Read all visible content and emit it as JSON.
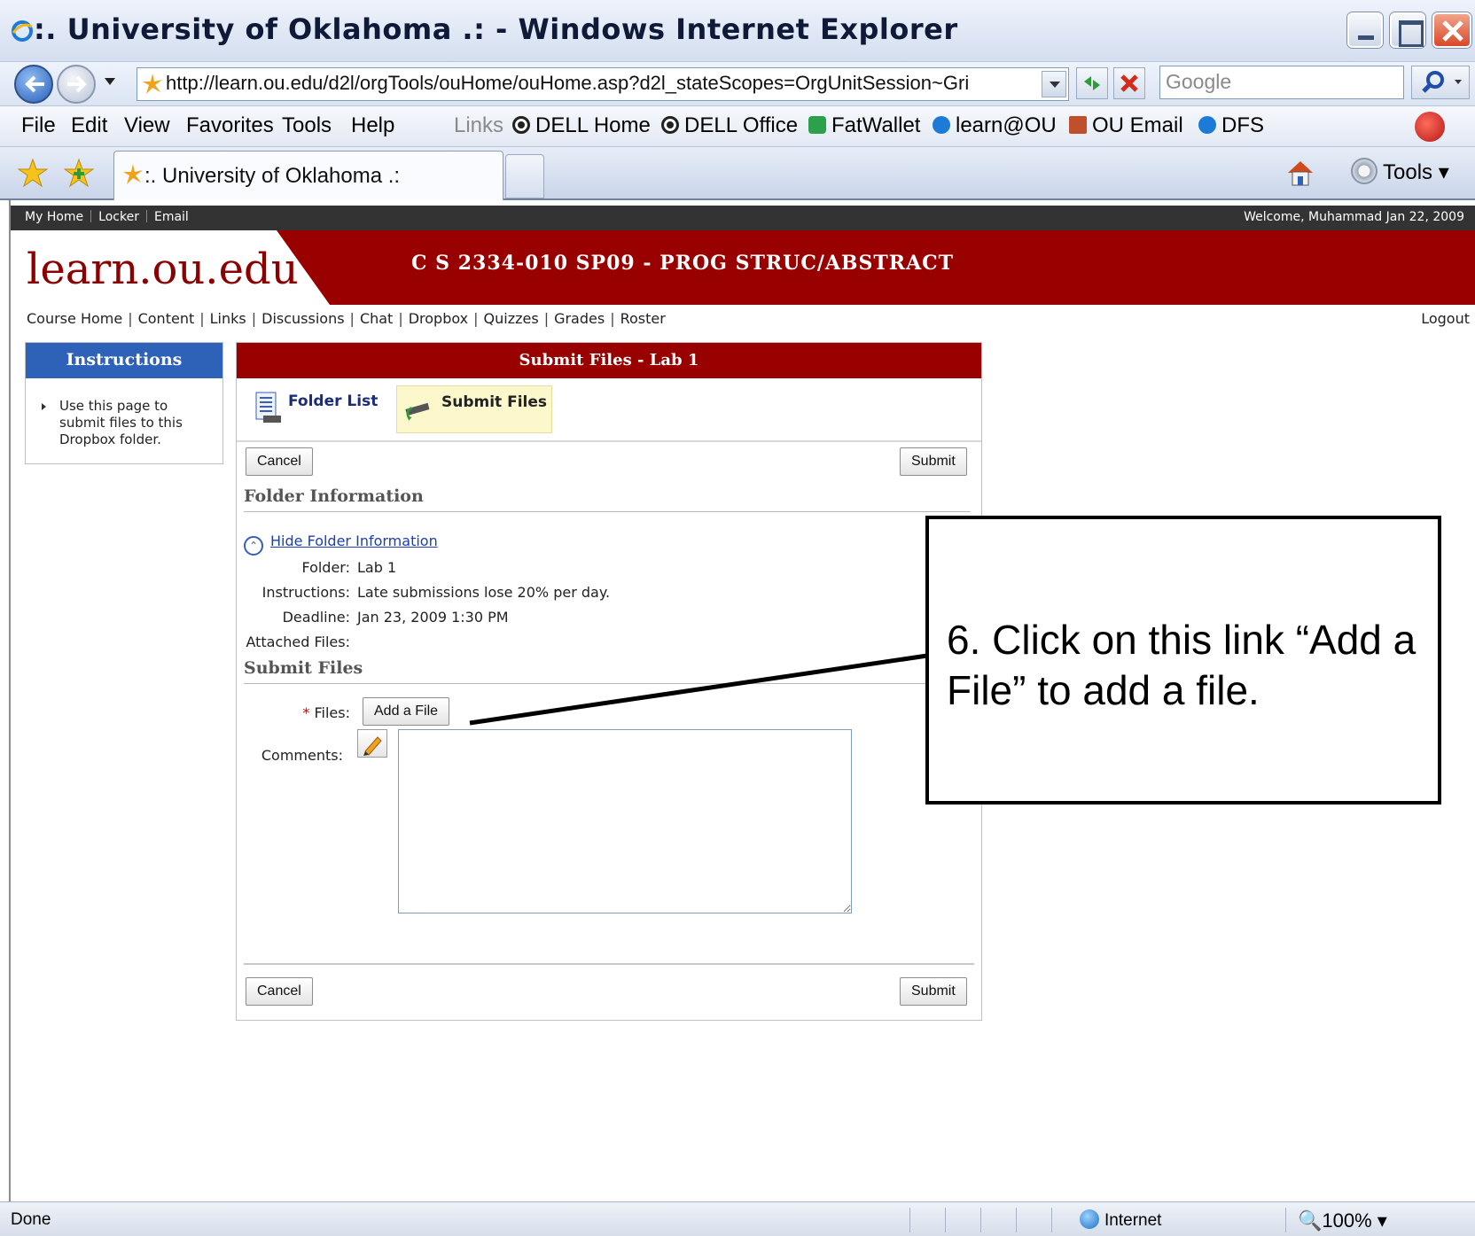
{
  "window": {
    "title": ":. University of Oklahoma .: - Windows Internet Explorer"
  },
  "address_bar": {
    "url": "http://learn.ou.edu/d2l/orgTools/ouHome/ouHome.asp?d2l_stateScopes=OrgUnitSession~Gri",
    "search_placeholder": "Google"
  },
  "menu": {
    "items": [
      "File",
      "Edit",
      "View",
      "Favorites",
      "Tools",
      "Help"
    ],
    "links_label": "Links",
    "links": [
      "DELL Home",
      "DELL Office",
      "FatWallet",
      "learn@OU",
      "OU Email",
      "DFS"
    ]
  },
  "tabs": {
    "active_tab": ":. University of Oklahoma .:",
    "tools_label": "Tools"
  },
  "minibar": {
    "links": [
      "My Home",
      "Locker",
      "Email"
    ],
    "welcome": "Welcome, Muhammad Jan 22, 2009"
  },
  "banner": {
    "logo": "learn.ou.edu",
    "course_title": "C S 2334-010 SP09 - PROG STRUC/ABSTRACT"
  },
  "course_nav": {
    "items": [
      "Course Home",
      "Content",
      "Links",
      "Discussions",
      "Chat",
      "Dropbox",
      "Quizzes",
      "Grades",
      "Roster"
    ],
    "logout": "Logout"
  },
  "instructions": {
    "title": "Instructions",
    "text": "Use this page to submit files to this Dropbox folder."
  },
  "panel": {
    "title": "Submit Files - Lab 1",
    "tabs": {
      "folder_list": "Folder List",
      "submit_files": "Submit Files"
    },
    "cancel_label": "Cancel",
    "submit_label": "Submit",
    "folder_info_header": "Folder Information",
    "hide_info_link": "Hide Folder Information",
    "folder_label": "Folder:",
    "folder_value": "Lab 1",
    "instructions_label": "Instructions:",
    "instructions_value": "Late submissions lose 20% per day.",
    "deadline_label": "Deadline:",
    "deadline_value": "Jan 23, 2009 1:30 PM",
    "attached_label": "Attached Files:",
    "submit_files_header": "Submit Files",
    "files_required": "*",
    "files_label": "Files:",
    "add_file_label": "Add a File",
    "comments_label": "Comments:"
  },
  "callout": {
    "text": "6. Click on this link “Add a File” to add a file."
  },
  "status_bar": {
    "status": "Done",
    "zone": "Internet",
    "zoom": "100%"
  }
}
